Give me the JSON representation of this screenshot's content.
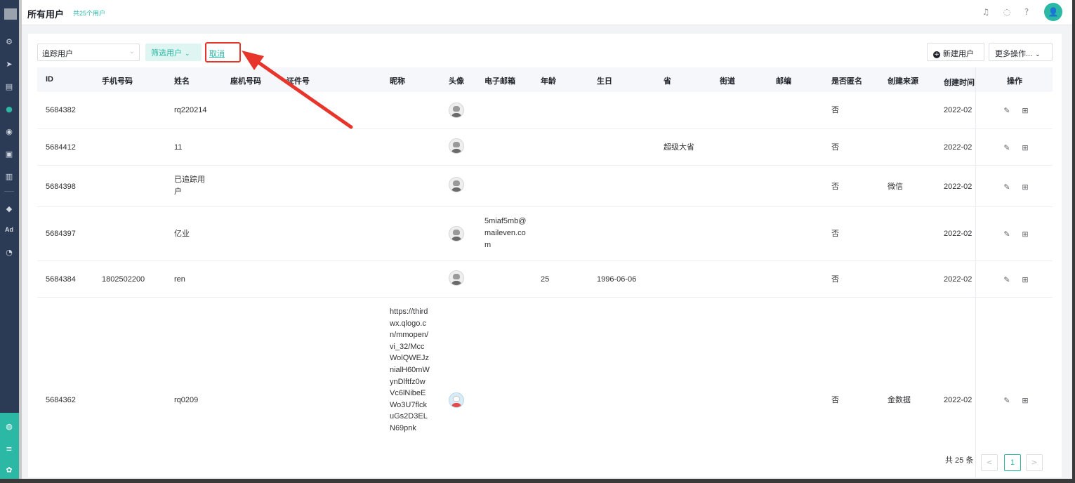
{
  "header": {
    "title": "所有用户",
    "count_text": "共25个用户",
    "avatar_glyph": "👤"
  },
  "toolbar": {
    "select_value": "追踪用户",
    "filter_label": "筛选用户",
    "cancel_label": "取消",
    "new_user_label": "新建用户",
    "more_label": "更多操作..."
  },
  "table": {
    "columns": [
      "ID",
      "手机号码",
      "姓名",
      "座机号码",
      "证件号",
      "昵称",
      "头像",
      "电子邮箱",
      "年龄",
      "生日",
      "省",
      "街道",
      "邮编",
      "是否匿名",
      "创建来源",
      "创建时间",
      "操作"
    ],
    "rows": [
      {
        "id": "5684382",
        "phone": "",
        "name": "rq220214",
        "nickname": "",
        "avatar": "default",
        "email": "",
        "age": "",
        "birthday": "",
        "province": "",
        "anonymous": "否",
        "source": "",
        "created": "2022-02"
      },
      {
        "id": "5684412",
        "phone": "",
        "name": "11",
        "nickname": "",
        "avatar": "default",
        "email": "",
        "age": "",
        "birthday": "",
        "province": "超级大省",
        "anonymous": "否",
        "source": "",
        "created": "2022-02"
      },
      {
        "id": "5684398",
        "phone": "",
        "name": "已追踪用户",
        "nickname": "",
        "avatar": "default",
        "email": "",
        "age": "",
        "birthday": "",
        "province": "",
        "anonymous": "否",
        "source": "微信",
        "created": "2022-02"
      },
      {
        "id": "5684397",
        "phone": "",
        "name": "亿业",
        "nickname": "",
        "avatar": "default",
        "email": "5miaf5mb@maileven.com",
        "age": "",
        "birthday": "",
        "province": "",
        "anonymous": "否",
        "source": "",
        "created": "2022-02"
      },
      {
        "id": "5684384",
        "phone": "1802502200",
        "name": "ren",
        "nickname": "",
        "avatar": "default",
        "email": "",
        "age": "25",
        "birthday": "1996-06-06",
        "province": "",
        "anonymous": "否",
        "source": "",
        "created": "2022-02"
      },
      {
        "id": "5684362",
        "phone": "",
        "name": "rq0209",
        "nickname": "https://thirdwx.qlogo.cn/mmopen/vi_32/MccWolQWEJznialH60mWynDlftfz0wVc6lNibeEWo3U7flckuGs2D3ELN69pnk",
        "avatar": "cartoon",
        "email": "",
        "age": "",
        "birthday": "",
        "province": "",
        "anonymous": "否",
        "source": "金数据",
        "created": "2022-02"
      }
    ]
  },
  "pagination": {
    "total_text": "共 25 条",
    "prev": "<",
    "current": "1",
    "next": ">"
  },
  "colors": {
    "accent": "#2bb8a5",
    "annotation": "#e8352c",
    "sidebar": "#2b3a55"
  }
}
